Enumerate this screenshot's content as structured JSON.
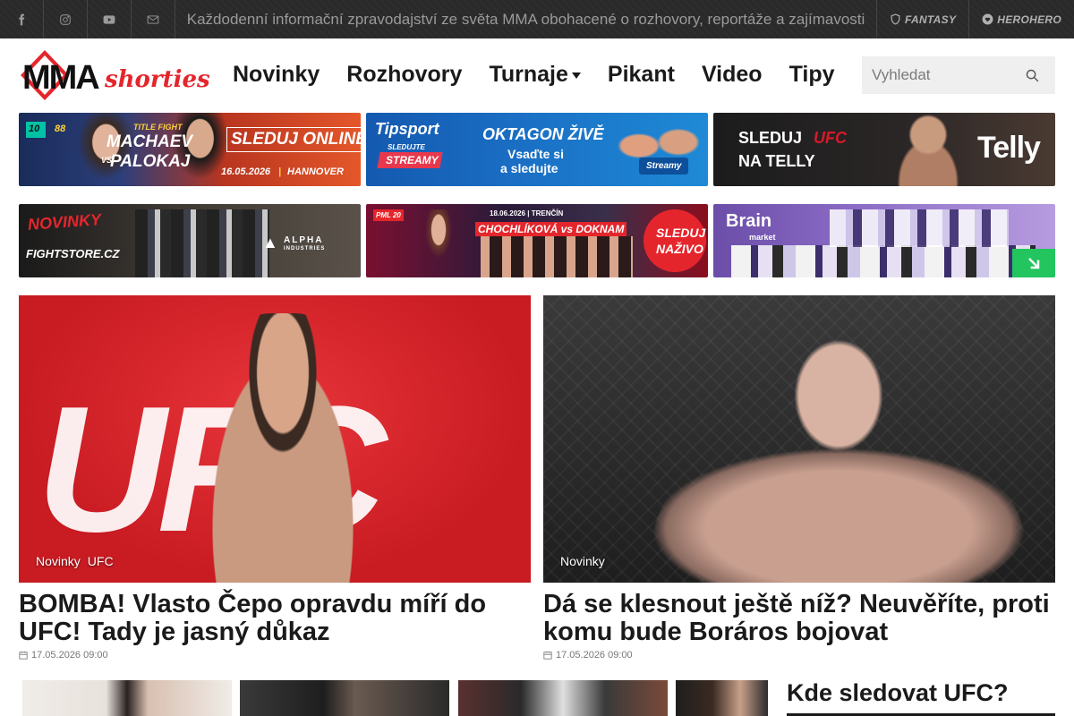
{
  "topbar": {
    "tagline": "Každodenní informační zpravodajství ze světa MMA obohacené o rozhovory, reportáže a zajímavosti",
    "social_icons": [
      "facebook-icon",
      "instagram-icon",
      "youtube-icon",
      "mail-icon"
    ],
    "links": [
      {
        "label": "FANTASY",
        "icon": "shield-icon"
      },
      {
        "label": "HEROHERO",
        "icon": "heart-icon"
      }
    ]
  },
  "header": {
    "logo": {
      "main": "MMA",
      "script": "shorties"
    },
    "nav": [
      {
        "label": "Novinky"
      },
      {
        "label": "Rozhovory"
      },
      {
        "label": "Turnaje"
      },
      {
        "label": "Pikant"
      },
      {
        "label": "Video"
      },
      {
        "label": "Tipy"
      }
    ],
    "search_placeholder": "Vyhledat"
  },
  "banners": {
    "b1": {
      "badge1": "10",
      "badge2": "88",
      "sub": "TITLE FIGHT",
      "f1": "MACHAEV",
      "vs": "VS",
      "f2": "PALOKAJ",
      "cta": "SLEDUJ ONLINE",
      "date": "16.05.2026",
      "sep": "|",
      "city": "HANNOVER"
    },
    "b2": {
      "brand": "Tipsport",
      "tag1": "SLEDUJTE",
      "tag2": "STREAMY",
      "headline": "OKTAGON ŽIVĚ",
      "sub1": "Vsaďte si",
      "sub2": "a sledujte",
      "btn": "Streamy"
    },
    "b3": {
      "line1": "SLEDUJ",
      "ufc": "UFC",
      "line2": "NA TELLY",
      "brand": "Telly"
    },
    "b4": {
      "label": "NOVINKY",
      "shop": "FIGHTSTORE.CZ",
      "brand1": "ALPHA",
      "brand2": "INDUSTRIES"
    },
    "b5": {
      "org": "PML 20",
      "top": "18.06.2026 | TRENČÍN",
      "main": "CHOCHLÍKOVÁ vs DOKNAM",
      "cta1": "SLEDUJ",
      "cta2": "NAŽIVO"
    },
    "b6": {
      "brand": "Brain",
      "sub": "market"
    }
  },
  "articles": [
    {
      "tags": [
        "Novinky",
        "UFC"
      ],
      "title": "BOMBA! Vlasto Čepo opravdu míří do UFC! Tady je jasný důkaz",
      "date": "17.05.2026 09:00",
      "img_text": "UFC"
    },
    {
      "tags": [
        "Novinky"
      ],
      "title": "Dá se klesnout ještě níž? Neuvěříte, proti komu bude Boráros bojovat",
      "date": "17.05.2026 09:00"
    }
  ],
  "sidebar": {
    "title": "Kde sledovat UFC?"
  },
  "colors": {
    "accent_red": "#e4262c",
    "dark": "#2a2a2a",
    "tipsport_blue": "#1a6fc4",
    "telly_red": "#d71a2a"
  }
}
